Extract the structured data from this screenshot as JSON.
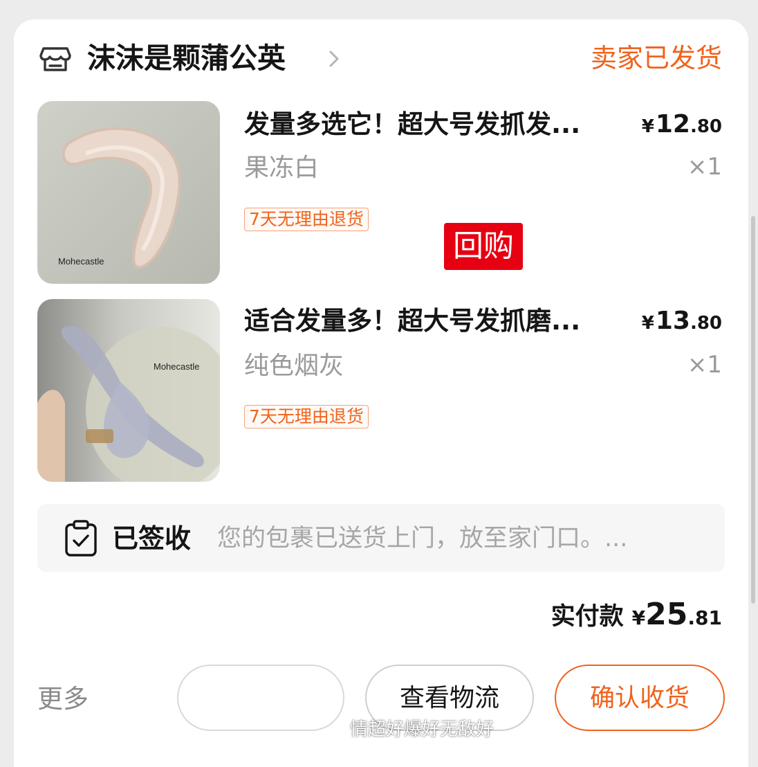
{
  "shop": {
    "name": "沫沫是颗蒲公英",
    "status": "卖家已发货"
  },
  "items": [
    {
      "title": "发量多选它！超大号发抓发...",
      "currency": "¥",
      "price_int": "12",
      "price_dec": ".80",
      "variant": "果冻白",
      "qty": "×1",
      "badge": "7天无理由退货",
      "image_brand": "Mohecastle"
    },
    {
      "title": "适合发量多！超大号发抓磨...",
      "currency": "¥",
      "price_int": "13",
      "price_dec": ".80",
      "variant": "纯色烟灰",
      "qty": "×1",
      "badge": "7天无理由退货",
      "image_brand": "Mohecastle"
    }
  ],
  "overlay_tag": "回购",
  "logistics": {
    "status": "已签收",
    "detail": "您的包裹已送货上门，放至家门口。..."
  },
  "total": {
    "label": "实付款",
    "currency": "¥",
    "int": "25",
    "dec": ".81"
  },
  "actions": {
    "more": "更多",
    "blank_button": "",
    "logistics": "查看物流",
    "confirm": "确认收货"
  },
  "watermark": "情超好爆好无敌好",
  "colors": {
    "accent": "#f0631c",
    "tag_red": "#e60012",
    "text_primary": "#151515",
    "text_secondary": "#9a9a9a"
  },
  "icons": [
    "store-icon",
    "chevron-right-icon",
    "clipboard-check-icon"
  ]
}
